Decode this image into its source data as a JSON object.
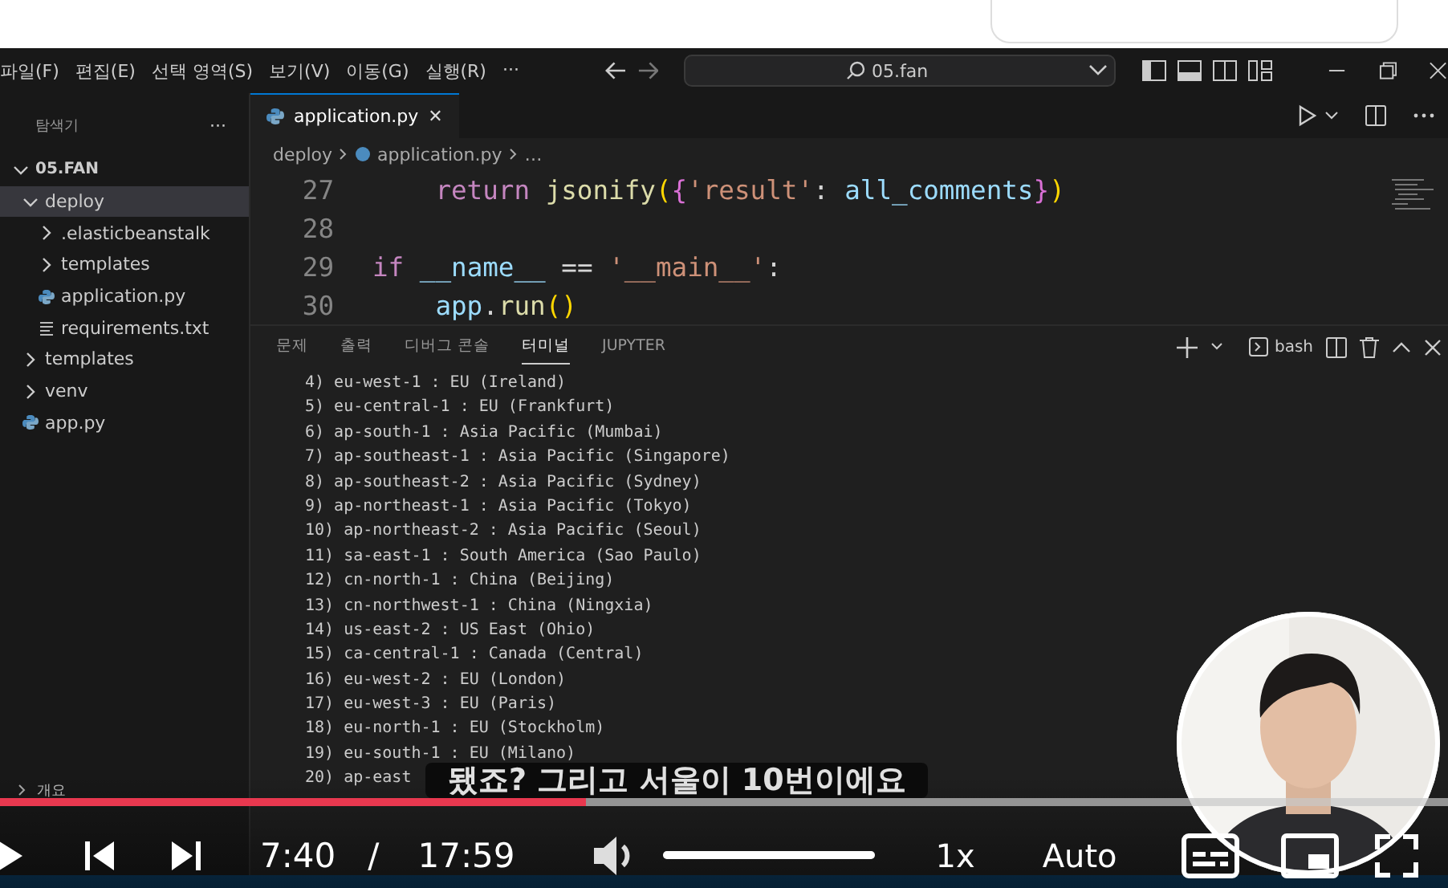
{
  "menu": [
    "파일(F)",
    "편집(E)",
    "선택 영역(S)",
    "보기(V)",
    "이동(G)",
    "실행(R)",
    "···"
  ],
  "command_center": {
    "value": "05.fan"
  },
  "explorer": {
    "title": "탐색기",
    "more": "···",
    "root": {
      "label": "05.FAN",
      "expanded": true,
      "children": [
        {
          "label": "deploy",
          "kind": "folder",
          "expanded": true,
          "selected": true,
          "children": [
            {
              "label": ".elasticbeanstalk",
              "kind": "folder",
              "expanded": false,
              "selected": false
            },
            {
              "label": "templates",
              "kind": "folder",
              "expanded": false,
              "selected": false
            },
            {
              "label": "application.py",
              "kind": "python",
              "selected": false
            },
            {
              "label": "requirements.txt",
              "kind": "text",
              "selected": false
            }
          ]
        },
        {
          "label": "templates",
          "kind": "folder",
          "expanded": false,
          "selected": false
        },
        {
          "label": "venv",
          "kind": "folder",
          "expanded": false,
          "selected": false
        },
        {
          "label": "app.py",
          "kind": "python",
          "selected": false
        }
      ]
    },
    "sections": [
      {
        "label": "개요",
        "expanded": false
      }
    ]
  },
  "editor_tabs": [
    {
      "label": "application.py",
      "selected": true,
      "close": "✕"
    }
  ],
  "breadcrumbs": [
    "deploy",
    "application.py",
    "…"
  ],
  "code_lines": [
    {
      "number": "27",
      "indented": true,
      "tokens": [
        {
          "text": "return ",
          "kind": "keyword"
        },
        {
          "text": "jsonify",
          "kind": "function"
        },
        {
          "text": "(",
          "kind": "paren"
        },
        {
          "text": "{",
          "kind": "brace"
        },
        {
          "text": "'result'",
          "kind": "string"
        },
        {
          "text": ": ",
          "kind": "plain"
        },
        {
          "text": "all_comments",
          "kind": "variable"
        },
        {
          "text": "}",
          "kind": "brace"
        },
        {
          "text": ")",
          "kind": "paren"
        }
      ]
    },
    {
      "number": "28"
    },
    {
      "number": "29",
      "indented": false,
      "tokens": [
        {
          "text": "if ",
          "kind": "keyword"
        },
        {
          "text": "__name__",
          "kind": "variable"
        },
        {
          "text": " == ",
          "kind": "plain"
        },
        {
          "text": "'__main__'",
          "kind": "string"
        },
        {
          "text": ":",
          "kind": "plain"
        }
      ]
    },
    {
      "number": "30",
      "indented": true,
      "tokens": [
        {
          "text": "app",
          "kind": "variable"
        },
        {
          "text": ".",
          "kind": "plain"
        },
        {
          "text": "run",
          "kind": "function"
        },
        {
          "text": "()",
          "kind": "paren"
        }
      ]
    }
  ],
  "panel_tabs": [
    {
      "label": "문제",
      "selected": false
    },
    {
      "label": "출력",
      "selected": false
    },
    {
      "label": "디버그 콘솔",
      "selected": false
    },
    {
      "label": "터미널",
      "selected": true
    },
    {
      "label": "JUPYTER",
      "selected": false
    }
  ],
  "terminal_name": "bash",
  "terminal_lines": [
    "4) eu-west-1 : EU (Ireland)",
    "5) eu-central-1 : EU (Frankfurt)",
    "6) ap-south-1 : Asia Pacific (Mumbai)",
    "7) ap-southeast-1 : Asia Pacific (Singapore)",
    "8) ap-southeast-2 : Asia Pacific (Sydney)",
    "9) ap-northeast-1 : Asia Pacific (Tokyo)",
    "10) ap-northeast-2 : Asia Pacific (Seoul)",
    "11) sa-east-1 : South America (Sao Paulo)",
    "12) cn-north-1 : China (Beijing)",
    "13) cn-northwest-1 : China (Ningxia)",
    "14) us-east-2 : US East (Ohio)",
    "15) ca-central-1 : Canada (Central)",
    "16) eu-west-2 : EU (London)",
    "17) eu-west-3 : EU (Paris)",
    "18) eu-north-1 : EU (Stockholm)",
    "19) eu-south-1 : EU (Milano)",
    "20) ap-east"
  ],
  "subtitle": "됐죠? 그리고 서울이 10번이에요",
  "player": {
    "progress": {
      "level": 0.405
    },
    "current_time": "7:40",
    "separator": "/",
    "duration": "17:59",
    "volume": {
      "level": 1
    },
    "speed": "1x",
    "quality": "Auto"
  },
  "webcam": {
    "kind": "picture"
  }
}
